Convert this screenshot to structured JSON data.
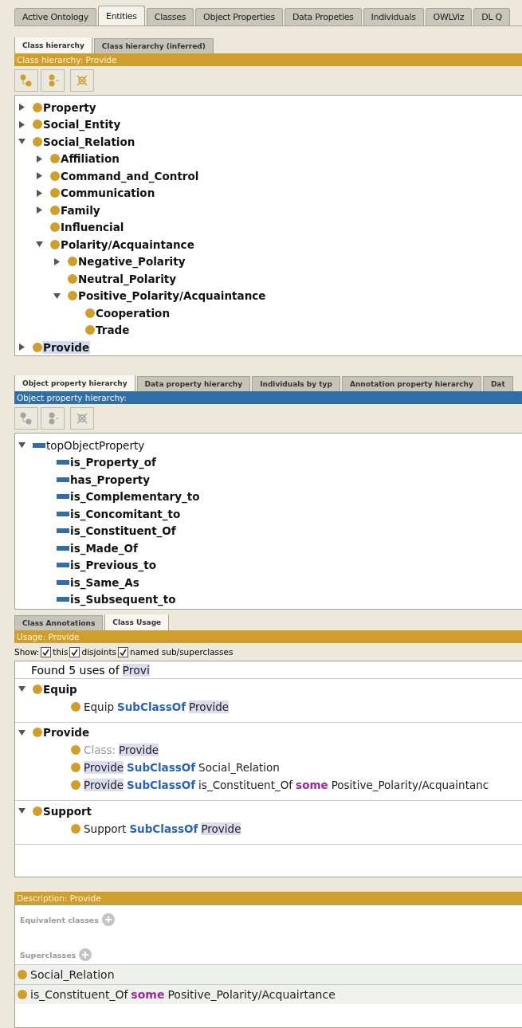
{
  "main_tabs": [
    {
      "label": "Active Ontology",
      "selected": false
    },
    {
      "label": "Entities",
      "selected": true
    },
    {
      "label": "Classes",
      "selected": false
    },
    {
      "label": "Object Properties",
      "selected": false
    },
    {
      "label": "Data Propeties",
      "selected": false
    },
    {
      "label": "Individuals",
      "selected": false
    },
    {
      "label": "OWLViz",
      "selected": false
    },
    {
      "label": "DL Q",
      "selected": false
    }
  ],
  "class_panel": {
    "tabs": [
      {
        "label": "Class hierarchy",
        "selected": true
      },
      {
        "label": "Class hierarchy (inferred)",
        "selected": false
      }
    ],
    "header": "Class hierarchy: Provide",
    "tree": [
      {
        "label": "Property",
        "expanded": false,
        "selected": false
      },
      {
        "label": "Social_Entity",
        "expanded": false,
        "selected": false
      },
      {
        "label": "Social_Relation",
        "expanded": true,
        "selected": false,
        "children": [
          {
            "label": "Affiliation",
            "expanded": false,
            "selected": false
          },
          {
            "label": "Command_and_Control",
            "expanded": false,
            "selected": false
          },
          {
            "label": "Communication",
            "expanded": false,
            "selected": false
          },
          {
            "label": "Family",
            "expanded": false,
            "selected": false
          },
          {
            "label": "Influencial",
            "selected": false
          },
          {
            "label": "Polarity/Acquaintance",
            "expanded": true,
            "selected": false,
            "children": [
              {
                "label": "Negative_Polarity",
                "expanded": false,
                "selected": false
              },
              {
                "label": "Neutral_Polarity",
                "selected": false
              },
              {
                "label": "Positive_Polarity/Acquaintance",
                "expanded": true,
                "selected": false,
                "children": [
                  {
                    "label": "Cooperation",
                    "selected": false
                  },
                  {
                    "label": "Trade",
                    "selected": false
                  }
                ]
              }
            ]
          }
        ]
      },
      {
        "label": "Provide",
        "expanded": false,
        "selected": true
      }
    ]
  },
  "property_panel": {
    "tabs": [
      {
        "label": "Object property hierarchy",
        "selected": true
      },
      {
        "label": "Data property hierarchy",
        "selected": false
      },
      {
        "label": "Individuals by typ",
        "selected": false
      },
      {
        "label": "Annotation property hierarchy",
        "selected": false
      },
      {
        "label": "Dat",
        "selected": false
      }
    ],
    "header": "Object property hierarchy:",
    "tree": [
      {
        "label": "topObjectProperty",
        "expanded": true,
        "children": [
          {
            "label": "is_Property_of"
          },
          {
            "label": "has_Property"
          },
          {
            "label": "is_Complementary_to"
          },
          {
            "label": "is_Concomitant_to"
          },
          {
            "label": "is_Constituent_Of"
          },
          {
            "label": "is_Made_Of"
          },
          {
            "label": "is_Previous_to"
          },
          {
            "label": "is_Same_As"
          },
          {
            "label": "is_Subsequent_to"
          }
        ]
      }
    ]
  },
  "usage_panel": {
    "tabs": [
      {
        "label": "Class Annotations",
        "selected": false
      },
      {
        "label": "Class Usage",
        "selected": true
      }
    ],
    "header": "Usage: Provide",
    "show_label": "Show:",
    "show_options": [
      {
        "label": "this",
        "checked": true
      },
      {
        "label": "disjoints",
        "checked": true
      },
      {
        "label": "named sub/superclasses",
        "checked": true
      }
    ],
    "found_text": "Found 5 uses of",
    "found_term": "Provi",
    "groups": [
      {
        "label": "Equip",
        "expanded": true,
        "entries": [
          [
            {
              "kind": "text",
              "text": "Equip"
            },
            {
              "kind": "keyword",
              "text": "SubClassOf"
            },
            {
              "kind": "highlight",
              "text": "Provide"
            }
          ]
        ]
      },
      {
        "label": "Provide",
        "expanded": true,
        "entries": [
          [
            {
              "kind": "grey",
              "text": "Class:"
            },
            {
              "kind": "highlight",
              "text": "Provide"
            }
          ],
          [
            {
              "kind": "highlight",
              "text": "Provide"
            },
            {
              "kind": "keyword",
              "text": "SubClassOf"
            },
            {
              "kind": "text",
              "text": "Social_Relation"
            }
          ],
          [
            {
              "kind": "highlight",
              "text": "Provide"
            },
            {
              "kind": "keyword",
              "text": "SubClassOf"
            },
            {
              "kind": "text",
              "text": "is_Constituent_Of"
            },
            {
              "kind": "restriction",
              "text": "some"
            },
            {
              "kind": "text",
              "text": "Positive_Polarity/Acquaintanc"
            }
          ]
        ]
      },
      {
        "label": "Support",
        "expanded": true,
        "entries": [
          [
            {
              "kind": "text",
              "text": "Support"
            },
            {
              "kind": "keyword",
              "text": "SubClassOf"
            },
            {
              "kind": "highlight",
              "text": "Provide"
            }
          ]
        ]
      }
    ]
  },
  "description_panel": {
    "header": "Description: Provide",
    "sections": [
      {
        "label": "Equivalent classes"
      },
      {
        "label": "Superclasses",
        "rows": [
          [
            {
              "kind": "text",
              "text": "Social_Relation"
            }
          ],
          [
            {
              "kind": "text",
              "text": "is_Constituent_Of"
            },
            {
              "kind": "restriction",
              "text": "some"
            },
            {
              "kind": "text",
              "text": "Positive_Polarity/Acquairtance"
            }
          ]
        ]
      }
    ]
  }
}
